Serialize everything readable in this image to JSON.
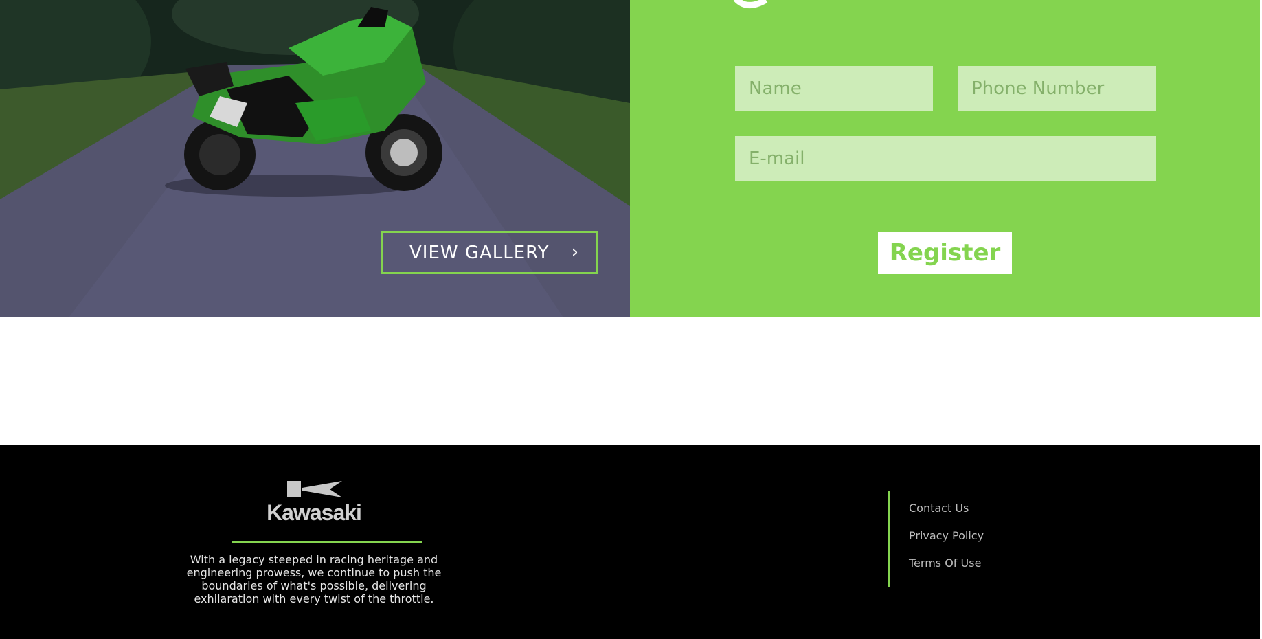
{
  "gallery": {
    "button_label": "VIEW GALLERY",
    "chevron": "›"
  },
  "register_form": {
    "name_placeholder": "Name",
    "phone_placeholder": "Phone Number",
    "email_placeholder": "E-mail",
    "submit_label": "Register"
  },
  "footer": {
    "brand": "Kawasaki",
    "tagline": "With a legacy steeped in racing heritage and engineering prowess, we continue to push the boundaries of what's possible, delivering exhilaration with every twist of the throttle.",
    "links": [
      "Contact Us",
      "Privacy Policy",
      "Terms Of Use"
    ]
  },
  "colors": {
    "accent": "#84d44f",
    "field_bg": "#cdecb8",
    "footer_bg": "#000000"
  },
  "icons": [
    "chevron-right-icon",
    "kawasaki-logo-mark-icon"
  ]
}
